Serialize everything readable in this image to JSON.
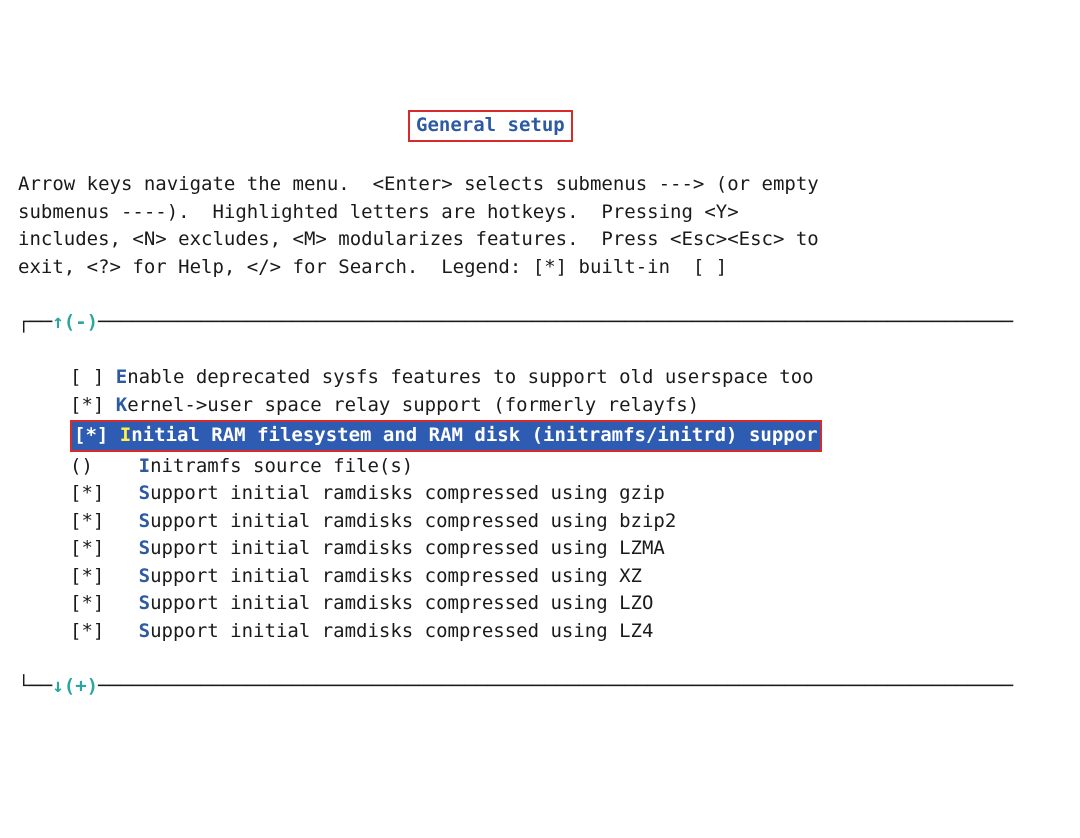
{
  "title": "General setup",
  "help_text": "Arrow keys navigate the menu.  <Enter> selects submenus ---> (or empty\nsubmenus ----).  Highlighted letters are hotkeys.  Pressing <Y>\nincludes, <N> excludes, <M> modularizes features.  Press <Esc><Esc> to\nexit, <?> for Help, </> for Search.  Legend: [*] built-in  [ ]",
  "scroll_up": "↑(-)",
  "scroll_down": "↓(+)",
  "items": [
    {
      "marker": "[ ]",
      "hotkey": "E",
      "text": "nable deprecated sysfs features to support old userspace too",
      "selected": false
    },
    {
      "marker": "[*]",
      "hotkey": "K",
      "text": "ernel->user space relay support (formerly relayfs)",
      "selected": false
    },
    {
      "marker": "[*]",
      "hotkey": "I",
      "text": "nitial RAM filesystem and RAM disk (initramfs/initrd) suppor",
      "selected": true
    },
    {
      "marker": "()",
      "spacer": "    ",
      "hotkey": "I",
      "text": "nitramfs source file(s)",
      "selected": false
    },
    {
      "marker": "[*]",
      "spacer": "   ",
      "hotkey": "S",
      "text": "upport initial ramdisks compressed using gzip",
      "selected": false
    },
    {
      "marker": "[*]",
      "spacer": "   ",
      "hotkey": "S",
      "text": "upport initial ramdisks compressed using bzip2",
      "selected": false
    },
    {
      "marker": "[*]",
      "spacer": "   ",
      "hotkey": "S",
      "text": "upport initial ramdisks compressed using LZMA",
      "selected": false
    },
    {
      "marker": "[*]",
      "spacer": "   ",
      "hotkey": "S",
      "text": "upport initial ramdisks compressed using XZ",
      "selected": false
    },
    {
      "marker": "[*]",
      "spacer": "   ",
      "hotkey": "S",
      "text": "upport initial ramdisks compressed using LZO",
      "selected": false
    },
    {
      "marker": "[*]",
      "spacer": "   ",
      "hotkey": "S",
      "text": "upport initial ramdisks compressed using LZ4",
      "selected": false
    }
  ]
}
